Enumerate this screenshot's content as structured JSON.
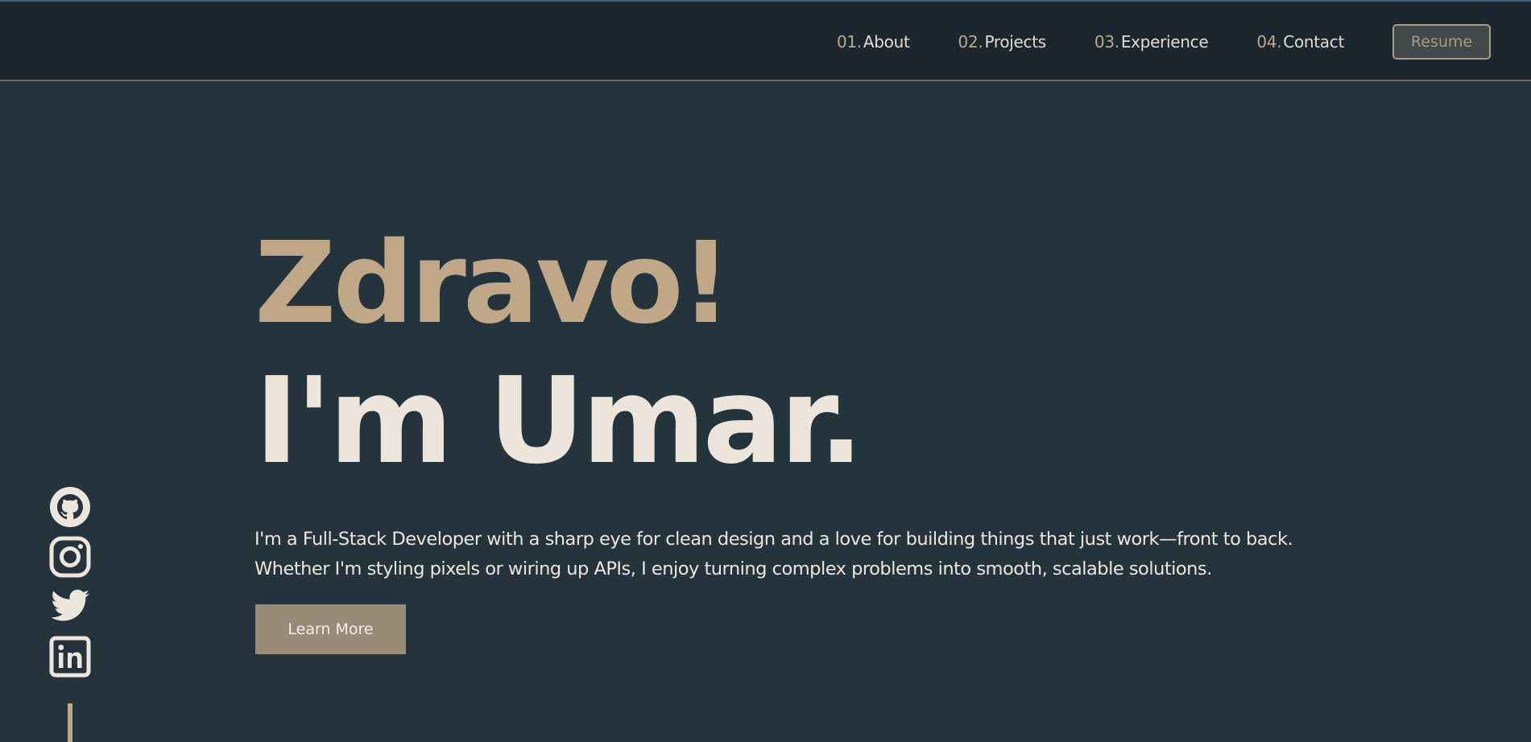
{
  "nav": {
    "items": [
      {
        "num": "01.",
        "label": "About"
      },
      {
        "num": "02.",
        "label": "Projects"
      },
      {
        "num": "03.",
        "label": "Experience"
      },
      {
        "num": "04.",
        "label": "Contact"
      }
    ],
    "resume_label": "Resume"
  },
  "hero": {
    "greeting": "Zdravo!",
    "name": "I'm Umar.",
    "bio_line1": "I'm a Full-Stack Developer with a sharp eye for clean design and a love for building things that just work—front to back.",
    "bio_line2": "Whether I'm styling pixels or wiring up APIs, I enjoy turning complex problems into smooth, scalable solutions.",
    "cta_label": "Learn More"
  },
  "socials": [
    {
      "icon": "github-icon"
    },
    {
      "icon": "instagram-icon"
    },
    {
      "icon": "twitter-icon"
    },
    {
      "icon": "linkedin-icon"
    }
  ],
  "colors": {
    "background": "#24333c",
    "header": "#1c262e",
    "accent": "#c0a788",
    "text": "#ede4dc",
    "button": "#9a8b78"
  }
}
